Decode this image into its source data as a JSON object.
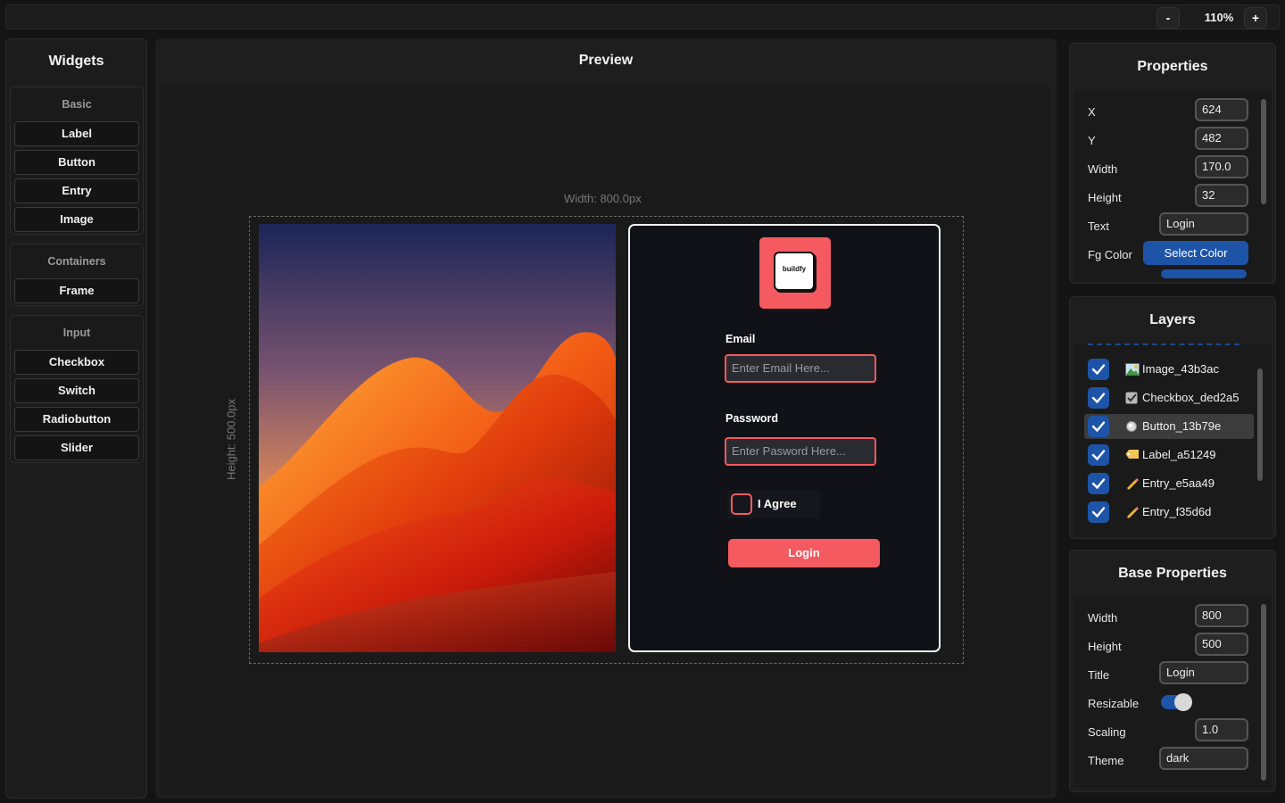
{
  "topbar": {
    "zoom_out": "-",
    "zoom_level": "110%",
    "zoom_in": "+"
  },
  "widgets": {
    "title": "Widgets",
    "groups": [
      {
        "title": "Basic",
        "items": [
          "Label",
          "Button",
          "Entry",
          "Image"
        ]
      },
      {
        "title": "Containers",
        "items": [
          "Frame"
        ]
      },
      {
        "title": "Input",
        "items": [
          "Checkbox",
          "Switch",
          "Radiobutton",
          "Slider"
        ]
      }
    ]
  },
  "preview": {
    "title": "Preview",
    "width_label": "Width: 800.0px",
    "height_label": "Height: 500.0px",
    "logo_text": "buildfy",
    "email_label": "Email",
    "email_placeholder": "Enter Email Here...",
    "password_label": "Password",
    "password_placeholder": "Enter Pasword Here...",
    "agree_label": "I Agree",
    "login_label": "Login"
  },
  "properties": {
    "title": "Properties",
    "x_label": "X",
    "x_value": "624",
    "y_label": "Y",
    "y_value": "482",
    "width_label": "Width",
    "width_value": "170.0",
    "height_label": "Height",
    "height_value": "32",
    "text_label": "Text",
    "text_value": "Login",
    "fg_label": "Fg Color",
    "fg_button": "Select Color"
  },
  "layers": {
    "title": "Layers",
    "items": [
      {
        "name": "Image_43b3ac",
        "icon": "image-icon"
      },
      {
        "name": "Checkbox_ded2a5",
        "icon": "checkbox-icon"
      },
      {
        "name": "Button_13b79e",
        "icon": "button-icon"
      },
      {
        "name": "Label_a51249",
        "icon": "label-icon"
      },
      {
        "name": "Entry_e5aa49",
        "icon": "pencil-icon"
      },
      {
        "name": "Entry_f35d6d",
        "icon": "pencil-icon"
      }
    ]
  },
  "base_properties": {
    "title": "Base Properties",
    "width_label": "Width",
    "width_value": "800",
    "height_label": "Height",
    "height_value": "500",
    "title_label": "Title",
    "title_value": "Login",
    "resizable_label": "Resizable",
    "scaling_label": "Scaling",
    "scaling_value": "1.0",
    "theme_label": "Theme",
    "theme_value": "dark"
  },
  "colors": {
    "accent": "#f45a5f",
    "blue": "#1d54a8"
  }
}
